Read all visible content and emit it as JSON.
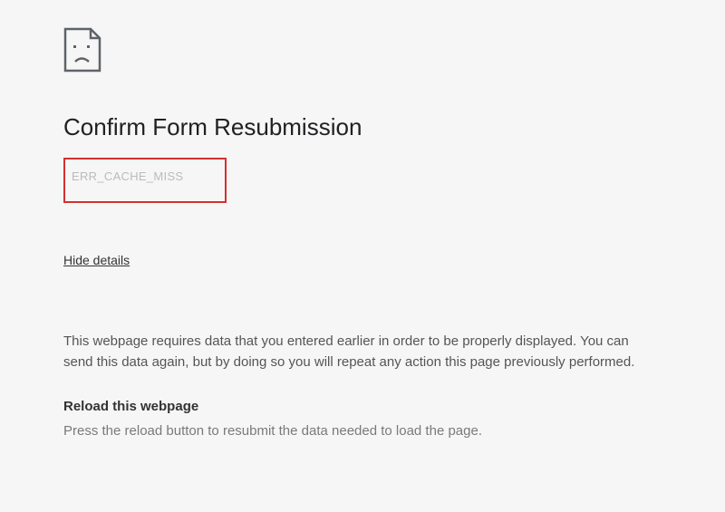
{
  "page": {
    "title": "Confirm Form Resubmission",
    "error_code": "ERR_CACHE_MISS",
    "hide_details_label": "Hide details",
    "description": "This webpage requires data that you entered earlier in order to be properly displayed. You can send this data again, but by doing so you will repeat any action this page previously performed.",
    "subheading": "Reload this webpage",
    "subdescription": "Press the reload button to resubmit the data needed to load the page."
  }
}
